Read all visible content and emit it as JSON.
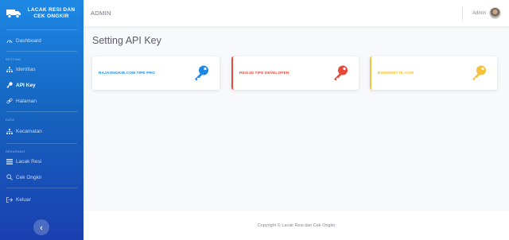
{
  "sidebar": {
    "brand": "LACAK RESI DAN CEK ONGKIR",
    "items": [
      {
        "label": "Dashboard",
        "icon": "dashboard-icon"
      },
      {
        "heading": "SETTING"
      },
      {
        "label": "Identitas",
        "icon": "sitemap-icon"
      },
      {
        "label": "API Key",
        "icon": "key-icon",
        "active": true
      },
      {
        "label": "Halaman",
        "icon": "link-icon"
      },
      {
        "heading": "DATA"
      },
      {
        "label": "Kecamatan",
        "icon": "sitemap-icon"
      },
      {
        "heading": "SEKARANG"
      },
      {
        "label": "Lacak Resi",
        "icon": "list-icon"
      },
      {
        "label": "Cek Ongkir",
        "icon": "search-icon"
      },
      {
        "label": "Keluar",
        "icon": "logout-icon"
      }
    ]
  },
  "topbar": {
    "title": "ADMIN",
    "user": "Admin"
  },
  "page": {
    "title": "Setting API Key"
  },
  "cards": [
    {
      "label": "RAJAONGKIR.COM TIPE PRO",
      "color": "#1e88e5"
    },
    {
      "label": "RESI.ID TIPE DEVELOPER",
      "color": "#e74a3b"
    },
    {
      "label": "BINDERBYTE.COM",
      "color": "#f6c23e"
    }
  ],
  "footer": {
    "text": "Copyright © Lacak Resi dan Cek Ongkir"
  }
}
